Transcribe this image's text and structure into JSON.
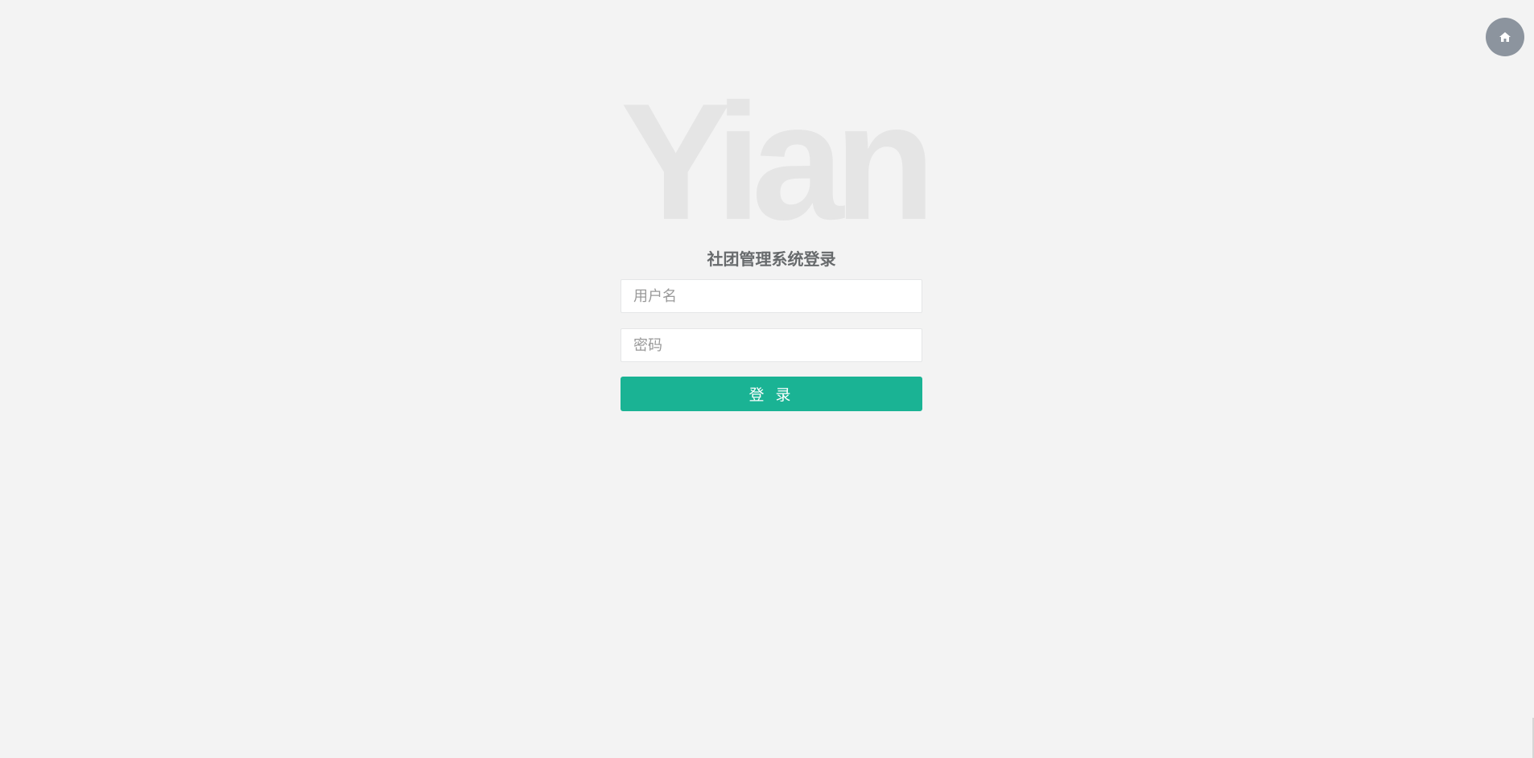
{
  "header": {
    "home_icon": "home-icon"
  },
  "logo": {
    "text": "Yian",
    "color": "#e5e5e5"
  },
  "login": {
    "title": "社团管理系统登录",
    "username_placeholder": "用户名",
    "username_value": "",
    "password_placeholder": "密码",
    "password_value": "",
    "submit_label": "登 录"
  },
  "colors": {
    "background": "#f3f3f3",
    "accent": "#1ab394",
    "home_button": "#8c949e",
    "title_text": "#676a6c"
  }
}
